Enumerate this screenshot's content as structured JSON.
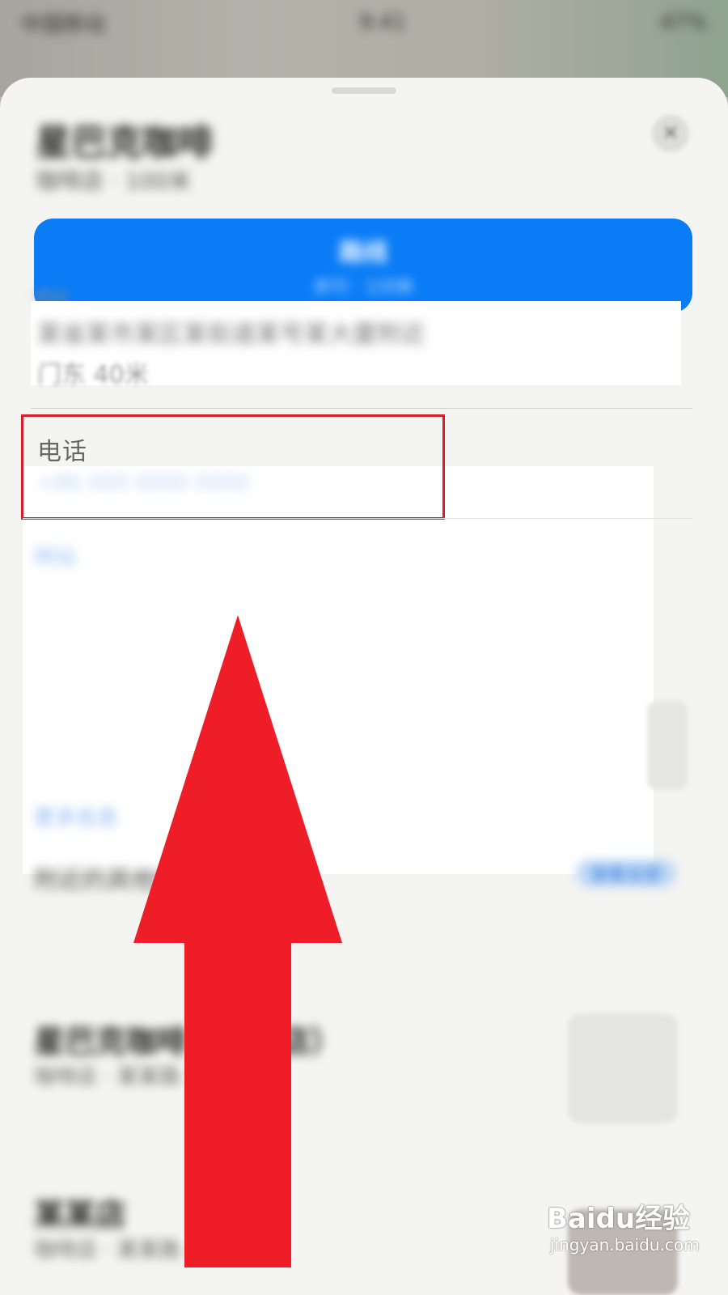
{
  "status_bar": {
    "left": "中国移动",
    "center": "9:41",
    "right": "47%"
  },
  "place": {
    "title": "星巴克咖啡",
    "subtitle": "咖啡店 · 100米"
  },
  "route_button": {
    "label": "路线",
    "sublabel": "步行 · 1分钟"
  },
  "address": {
    "label": "地址",
    "line1": "某省某市某区某街道某号某大厦附近",
    "line2": "门东 40米"
  },
  "phone": {
    "label": "电话",
    "value": "+86 000 0000 0000"
  },
  "website": {
    "link": "网站"
  },
  "ghost": {
    "t1": "",
    "t2": ""
  },
  "more": {
    "link": "更多信息"
  },
  "nearby": {
    "title": "附近的其他地点",
    "more_button": "查看全部"
  },
  "cards": [
    {
      "title": "星巴克咖啡（某某店）",
      "sub": "咖啡店 · 某某路 · 200米"
    },
    {
      "title": "某某店",
      "sub": "咖啡店 · 某某路 · 300米"
    }
  ],
  "colors": {
    "accent": "#0a7cf6",
    "highlight": "#d51f2b",
    "arrow": "#ee1d27"
  },
  "watermark": {
    "brand": "Baidu经验",
    "url": "jingyan.baidu.com"
  }
}
